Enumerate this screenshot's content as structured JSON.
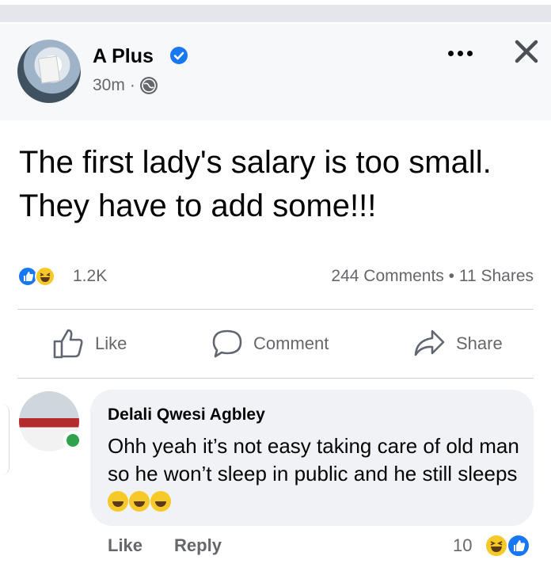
{
  "post": {
    "page_name": "A Plus",
    "time_ago": "30m",
    "separator": "·",
    "text": "The first lady's salary is too small. They have to add some!!!",
    "reaction_count": "1.2K",
    "comments_shares": "244 Comments • 11 Shares",
    "actions": {
      "like": "Like",
      "comment": "Comment",
      "share": "Share"
    }
  },
  "comment": {
    "author": "Delali Qwesi Agbley",
    "text": "Ohh yeah it’s not easy taking care of old man so he won’t sleep in public and he still sleeps",
    "like_label": "Like",
    "reply_label": "Reply",
    "reaction_count": "10"
  },
  "colors": {
    "accent": "#1877f2",
    "secondary_text": "#65676b",
    "bubble_bg": "#f0f2f5",
    "online": "#31a24c",
    "haha": "#f7c928"
  },
  "icons": [
    "verified-icon",
    "globe-icon",
    "more-icon",
    "close-icon",
    "like-icon",
    "comment-icon",
    "share-icon",
    "haha-reaction-icon",
    "like-reaction-icon"
  ]
}
